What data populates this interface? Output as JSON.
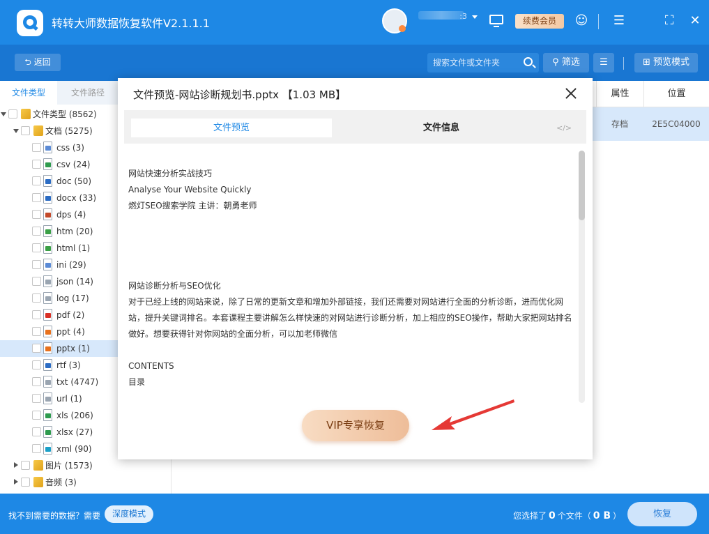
{
  "app": {
    "title": "转转大师数据恢复软件V2.1.1.1",
    "username": ":3",
    "vip_label": "续费会员"
  },
  "toolbar": {
    "back_label": "返回",
    "search_placeholder": "搜索文件或文件夹",
    "filter_label": "筛选",
    "preview_mode_label": "预览模式"
  },
  "sidebar": {
    "tabs": [
      "文件类型",
      "文件路径"
    ],
    "tree": [
      {
        "label": "文件类型 (8562)",
        "level": 0,
        "type": "folder",
        "expanded": true
      },
      {
        "label": "文档 (5275)",
        "level": 1,
        "type": "folder",
        "expanded": true
      },
      {
        "label": "css (3)",
        "level": 2,
        "type": "file",
        "badge": "#5b8bd6"
      },
      {
        "label": "csv (24)",
        "level": 2,
        "type": "file",
        "badge": "#2e9b4e"
      },
      {
        "label": "doc (50)",
        "level": 2,
        "type": "file",
        "badge": "#2b6cc4"
      },
      {
        "label": "docx (33)",
        "level": 2,
        "type": "file",
        "badge": "#2b6cc4"
      },
      {
        "label": "dps (4)",
        "level": 2,
        "type": "file",
        "badge": "#c44a2b"
      },
      {
        "label": "htm (20)",
        "level": 2,
        "type": "file",
        "badge": "#3aa046"
      },
      {
        "label": "html (1)",
        "level": 2,
        "type": "file",
        "badge": "#3aa046"
      },
      {
        "label": "ini (29)",
        "level": 2,
        "type": "file",
        "badge": "#5b8bd6"
      },
      {
        "label": "json (14)",
        "level": 2,
        "type": "file",
        "badge": "#9aa5b1"
      },
      {
        "label": "log (17)",
        "level": 2,
        "type": "file",
        "badge": "#9aa5b1"
      },
      {
        "label": "pdf (2)",
        "level": 2,
        "type": "file",
        "badge": "#d93025"
      },
      {
        "label": "ppt (4)",
        "level": 2,
        "type": "file",
        "badge": "#e8711c"
      },
      {
        "label": "pptx (1)",
        "level": 2,
        "type": "file",
        "badge": "#e8711c",
        "selected": true
      },
      {
        "label": "rtf (3)",
        "level": 2,
        "type": "file",
        "badge": "#2b6cc4"
      },
      {
        "label": "txt (4747)",
        "level": 2,
        "type": "file",
        "badge": "#9aa5b1"
      },
      {
        "label": "url (1)",
        "level": 2,
        "type": "file",
        "badge": "#9aa5b1"
      },
      {
        "label": "xls (206)",
        "level": 2,
        "type": "file",
        "badge": "#2e9b4e"
      },
      {
        "label": "xlsx (27)",
        "level": 2,
        "type": "file",
        "badge": "#2e9b4e"
      },
      {
        "label": "xml (90)",
        "level": 2,
        "type": "file",
        "badge": "#1aa0c8"
      },
      {
        "label": "图片 (1573)",
        "level": 1,
        "type": "folder",
        "expanded": false
      },
      {
        "label": "音频 (3)",
        "level": 1,
        "type": "folder",
        "expanded": false
      }
    ]
  },
  "table": {
    "headers": {
      "attr": "属性",
      "location": "位置"
    },
    "rows": [
      {
        "attr": "存档",
        "location": "2E5C04000"
      }
    ]
  },
  "modal": {
    "title": "文件预览-网站诊断规划书.pptx 【1.03 MB】",
    "tab_preview": "文件预览",
    "tab_info": "文件信息",
    "code_label": "</>",
    "preview_lines": [
      "网站快速分析实战技巧",
      "Analyse Your Website Quickly",
      "燃灯SEO搜索学院  主讲：朝勇老师",
      "网站诊断分析与SEO优化",
      "对于已经上线的网站来说，除了日常的更新文章和增加外部链接，我们还需要对网站进行全面的分析诊断，进而优化网站，提升关键词排名。本套课程主要讲解怎么样快速的对网站进行诊断分析，加上相应的SEO操作，帮助大家把网站排名做好。想要获得针对你网站的全面分析，可以加老师微信",
      "CONTENTS",
      "目录"
    ],
    "vip_recover_label": "VIP专享恢复"
  },
  "bottom": {
    "hint": "找不到需要的数据？需要",
    "deep_mode_label": "深度模式",
    "selected_prefix": "您选择了",
    "selected_count": "0",
    "selected_mid": "个文件（",
    "selected_size": "0 B",
    "selected_suffix": "）",
    "recover_label": "恢复"
  },
  "colors": {
    "primary": "#1e88e5",
    "toolbar": "#1976d2",
    "selection": "#d7e8fb",
    "vip_gold": "#f3c9a4",
    "annotation_red": "#e53935"
  }
}
